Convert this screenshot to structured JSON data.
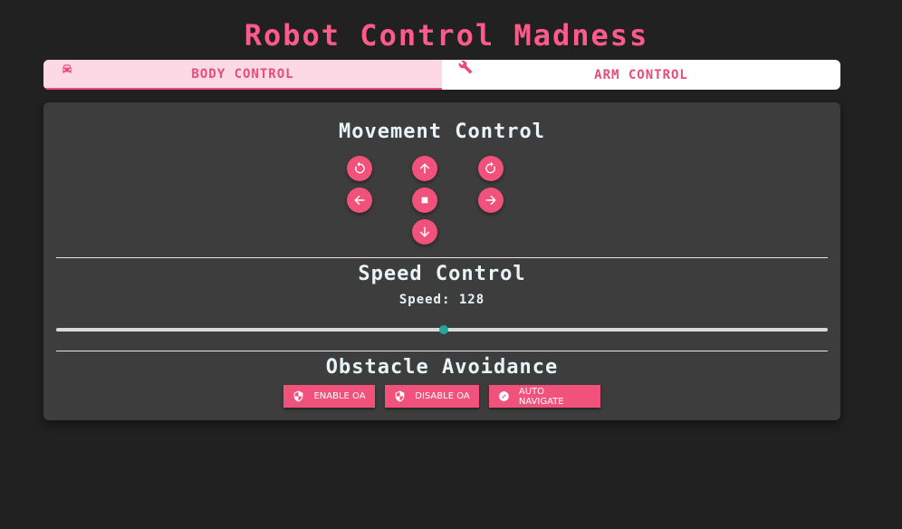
{
  "app": {
    "title": "Robot Control Madness"
  },
  "tabs": [
    {
      "label": "BODY CONTROL",
      "icon": "car-icon",
      "active": true
    },
    {
      "label": "ARM CONTROL",
      "icon": "wrench-icon",
      "active": false
    }
  ],
  "movement": {
    "title": "Movement Control",
    "buttons": [
      "rotate-left-icon",
      "arrow-up-icon",
      "rotate-right-icon",
      "arrow-left-icon",
      "stop-icon",
      "arrow-right-icon",
      "arrow-down-icon"
    ]
  },
  "speed": {
    "title": "Speed Control",
    "label": "Speed: 128",
    "value": 128,
    "min": 0,
    "max": 255
  },
  "obstacle": {
    "title": "Obstacle Avoidance",
    "buttons": [
      {
        "label": "ENABLE OA",
        "icon": "shield-icon"
      },
      {
        "label": "DISABLE OA",
        "icon": "shield-icon"
      },
      {
        "label": "AUTO NAVIGATE",
        "icon": "compass-icon"
      }
    ]
  },
  "colors": {
    "accent": "#f0527c",
    "background": "#212121",
    "panel": "#3d3d3d",
    "slider_thumb": "#26a69a"
  }
}
